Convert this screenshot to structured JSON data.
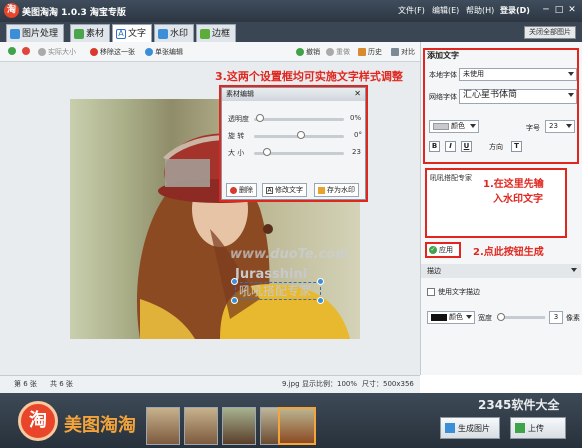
{
  "app": {
    "title": "美图淘淘 1.0.3 淘宝专版",
    "logo_char": "淘",
    "menus": [
      "文件(F)",
      "编辑(E)",
      "帮助(H)",
      "登录(D)"
    ],
    "window_controls": [
      "─",
      "□",
      "✕"
    ]
  },
  "tabs": [
    {
      "label": "图片处理",
      "color": "#3a8fd8"
    },
    {
      "label": "素材",
      "color": "#4aa64a"
    },
    {
      "label": "文字",
      "color": "#2f6fbf"
    },
    {
      "label": "水印",
      "color": "#3a8fd8"
    },
    {
      "label": "边框",
      "color": "#5cae3a"
    }
  ],
  "close_all_label": "关闭全部图片",
  "toolbar": {
    "actual_size": "实际大小",
    "remove_one": "移除这一张",
    "single_edit": "单张编辑",
    "undo": "撤销",
    "redo": "重做",
    "history": "历史",
    "compare": "对比"
  },
  "annotations": {
    "step3": "3.这两个设置框均可实施文字样式调整",
    "step1_line1": "1.在这里先输",
    "step1_line2": "入水印文字",
    "step2": "2.点此按钮生成"
  },
  "dialog": {
    "title": "素材编辑",
    "close": "✕",
    "sliders": [
      {
        "label": "透明度",
        "value_text": "0%",
        "level": 0.02
      },
      {
        "label": "旋  转",
        "value_text": "0°",
        "level": 0.5
      },
      {
        "label": "大  小",
        "value_text": "23",
        "level": 0.1
      }
    ],
    "buttons": [
      "删除",
      "修改文字",
      "存为水印"
    ]
  },
  "photo": {
    "watermark_text_1": "Jurasshini",
    "watermark_text_2": "吼吼搭配专家",
    "site_watermark": "www.duoTe.com"
  },
  "right_panel": {
    "section_title": "添加文字",
    "local_font_label": "本地字体",
    "local_font_value": "未使用",
    "web_font_label": "网络字体",
    "web_font_value": "汇心星书体简",
    "color_label": "颜色",
    "size_label": "字号",
    "size_value": "23",
    "format_buttons": [
      "B",
      "I",
      "U"
    ],
    "direction_label": "方向",
    "direction_button": "T",
    "text_input_value": "吼吼搭配专家",
    "apply_label": "应用",
    "stroke_section": "描边",
    "use_stroke_label": "使用文字描边",
    "stroke_color_label": "颜色",
    "width_label": "宽度",
    "width_value": "3",
    "unit_label": "像素",
    "text_color": "#c7c9cc",
    "stroke_color": "#111111"
  },
  "status": {
    "current": "第 6 张",
    "total": "共 6 张",
    "filename": "9.jpg",
    "ratio": "显示比例：100%",
    "size": "尺寸：500x356"
  },
  "bottom": {
    "brand": "美图淘淘",
    "brand_logo": "淘",
    "generate_button": "生成图片",
    "upload_button": "上传",
    "site_watermark": "2345软件大全"
  }
}
